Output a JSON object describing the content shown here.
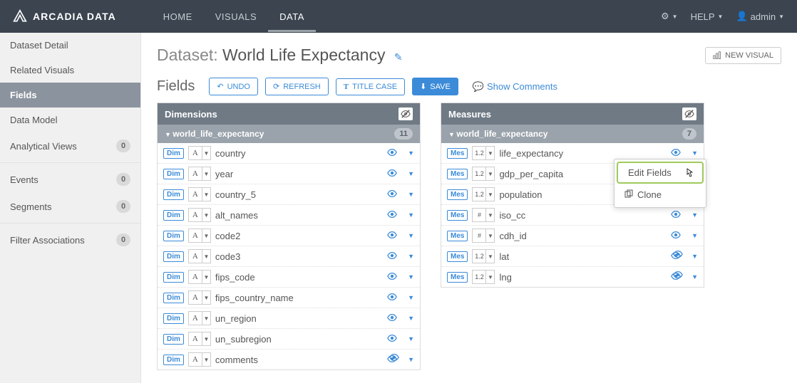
{
  "brand": "ARCADIA DATA",
  "topnav": {
    "home": "HOME",
    "visuals": "VISUALS",
    "data": "DATA"
  },
  "topright": {
    "help": "HELP",
    "user": "admin"
  },
  "sidebar": {
    "items": [
      {
        "label": "Dataset Detail"
      },
      {
        "label": "Related Visuals"
      },
      {
        "label": "Fields",
        "active": true
      },
      {
        "label": "Data Model"
      },
      {
        "label": "Analytical Views",
        "count": "0"
      }
    ],
    "items2": [
      {
        "label": "Events",
        "count": "0"
      },
      {
        "label": "Segments",
        "count": "0"
      }
    ],
    "items3": [
      {
        "label": "Filter Associations",
        "count": "0"
      }
    ]
  },
  "dataset": {
    "prefix": "Dataset: ",
    "name": "World Life Expectancy"
  },
  "buttons": {
    "new_visual": "NEW VISUAL",
    "undo": "UNDO",
    "refresh": "REFRESH",
    "titlecase": "TITLE CASE",
    "save": "SAVE",
    "show_comments": "Show Comments"
  },
  "fields_heading": "Fields",
  "dimensions": {
    "title": "Dimensions",
    "group": "world_life_expectancy",
    "count": "11",
    "tag": "Dim",
    "rows": [
      {
        "type": "A",
        "name": "country",
        "vis": "single"
      },
      {
        "type": "A",
        "name": "year",
        "vis": "single"
      },
      {
        "type": "A",
        "name": "country_5",
        "vis": "single"
      },
      {
        "type": "A",
        "name": "alt_names",
        "vis": "single"
      },
      {
        "type": "A",
        "name": "code2",
        "vis": "single"
      },
      {
        "type": "A",
        "name": "code3",
        "vis": "single"
      },
      {
        "type": "A",
        "name": "fips_code",
        "vis": "single"
      },
      {
        "type": "A",
        "name": "fips_country_name",
        "vis": "single"
      },
      {
        "type": "A",
        "name": "un_region",
        "vis": "single"
      },
      {
        "type": "A",
        "name": "un_subregion",
        "vis": "single"
      },
      {
        "type": "A",
        "name": "comments",
        "vis": "double"
      }
    ]
  },
  "measures": {
    "title": "Measures",
    "group": "world_life_expectancy",
    "count": "7",
    "tag": "Mes",
    "rows": [
      {
        "type": "1.2",
        "name": "life_expectancy",
        "vis": "single",
        "menu_open": true
      },
      {
        "type": "1.2",
        "name": "gdp_per_capita",
        "vis": "single"
      },
      {
        "type": "1.2",
        "name": "population",
        "vis": "single"
      },
      {
        "type": "#",
        "name": "iso_cc",
        "vis": "single"
      },
      {
        "type": "#",
        "name": "cdh_id",
        "vis": "single"
      },
      {
        "type": "1.2",
        "name": "lat",
        "vis": "double"
      },
      {
        "type": "1.2",
        "name": "lng",
        "vis": "double"
      }
    ]
  },
  "dropdown": {
    "edit": "Edit Fields",
    "clone": "Clone"
  }
}
